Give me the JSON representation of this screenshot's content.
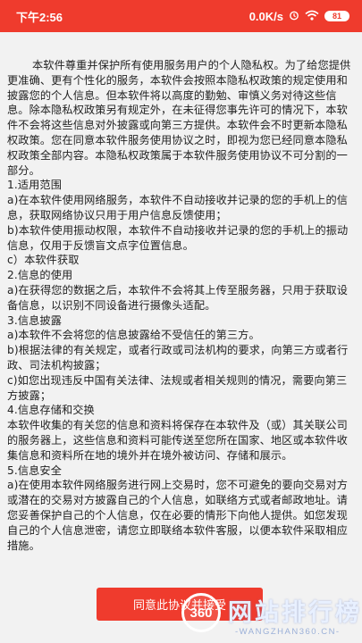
{
  "status_bar": {
    "time": "下午2:56",
    "network_speed": "0.0K/s",
    "alarm_icon": "alarm-clock-icon",
    "wifi_icon": "wifi-icon",
    "battery": "81",
    "accent": "#ef3b2d"
  },
  "privacy": {
    "intro": "本软件尊重并保护所有使用服务用户的个人隐私权。为了给您提供更准确、更有个性化的服务，本软件会按照本隐私权政策的规定使用和披露您的个人信息。但本软件将以高度的勤勉、审慎义务对待这些信息。除本隐私权政策另有规定外，在未征得您事先许可的情况下，本软件不会将这些信息对外披露或向第三方提供。本软件会不时更新本隐私权政策。您在同意本软件服务使用协议之时，即视为您已经同意本隐私权政策全部内容。本隐私权政策属于本软件服务使用协议不可分割的一部分。",
    "lines": [
      "1.适用范围",
      "a)在本软件使用网络服务，本软件不自动接收并记录的您的手机上的信息，获取网络协议只用于用户信息反馈使用；",
      "b)本软件使用振动权限，本软件不自动接收并记录的您的手机上的振动信息，仅用于反馈盲文点字位置信息。",
      "c）本软件获取",
      "2.信息的使用",
      "a)在获得您的数据之后，本软件不会将其上传至服务器，只用于获取设备信息，以识别不同设备进行摄像头适配。",
      "3.信息披露",
      "a)本软件不会将您的信息披露给不受信任的第三方。",
      "b)根据法律的有关规定，或者行政或司法机构的要求，向第三方或者行政、司法机构披露；",
      "c)如您出现违反中国有关法律、法规或者相关规则的情况，需要向第三方披露；",
      "4.信息存储和交换",
      "本软件收集的有关您的信息和资料将保存在本软件及（或）其关联公司的服务器上，这些信息和资料可能传送至您所在国家、地区或本软件收集信息和资料所在地的境外并在境外被访问、存储和展示。",
      "5.信息安全",
      "a)在使用本软件网络服务进行网上交易时，您不可避免的要向交易对方或潜在的交易对方披露自己的个人信息，如联络方式或者邮政地址。请您妥善保护自己的个人信息，仅在必要的情形下向他人提供。如您发现自己的个人信息泄密，请您立即联络本软件客服，以便本软件采取相应措施。"
    ]
  },
  "agree_button_label": "同意此协议并接受",
  "watermark": {
    "logo": "360",
    "title": "网站排行榜",
    "url": "-WANGZHAN360.CN-"
  }
}
